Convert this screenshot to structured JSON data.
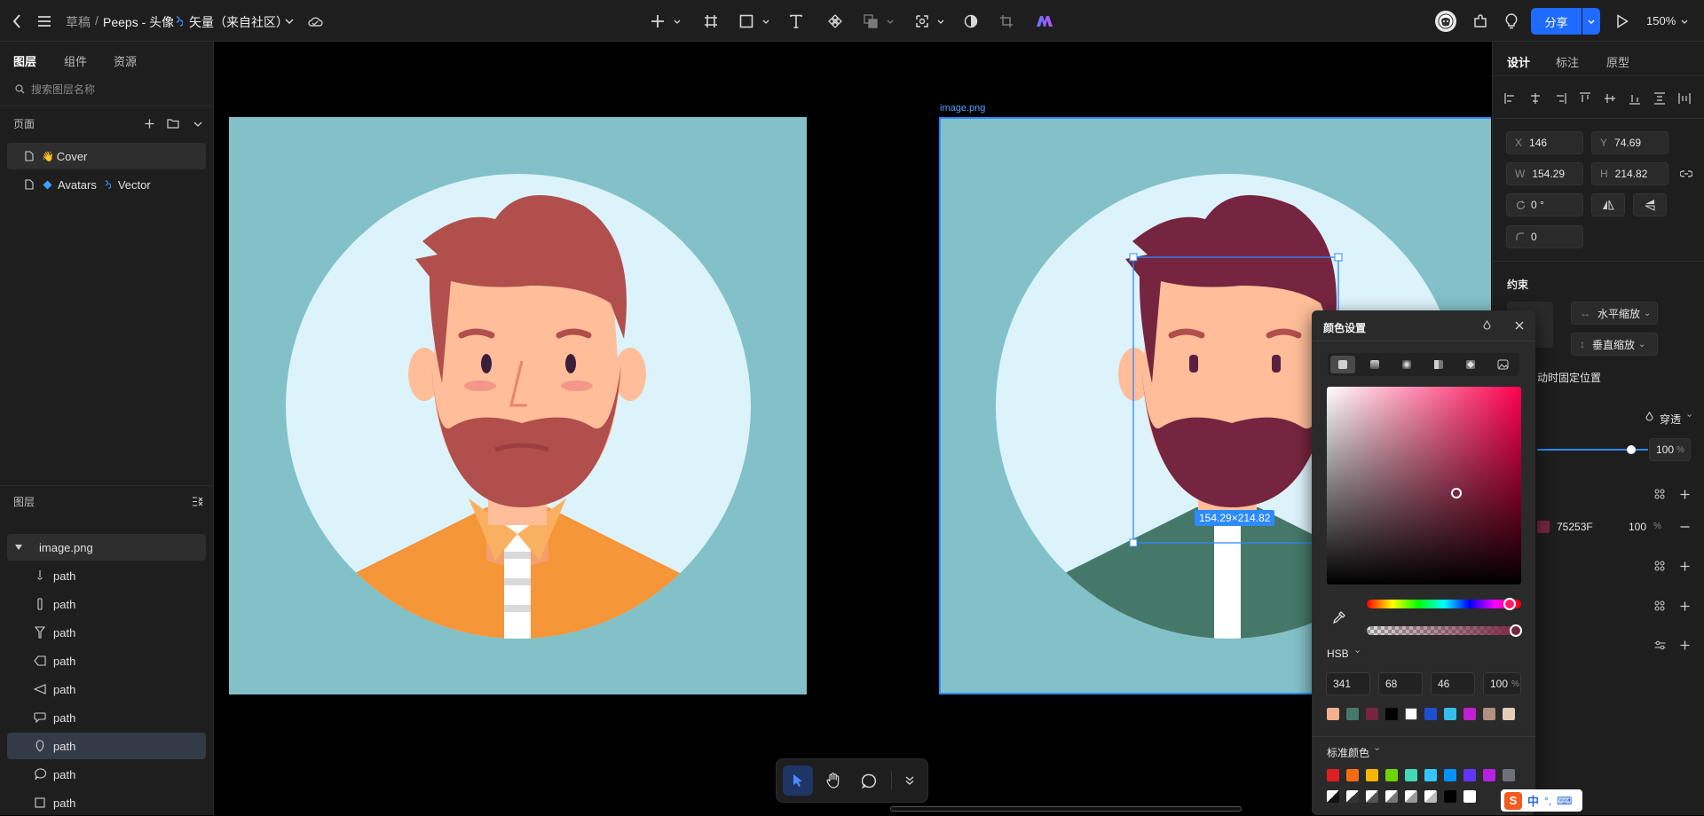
{
  "topbar": {
    "breadcrumb_root": "草稿",
    "breadcrumb_sep": "/",
    "file_title": "Peeps - 头像",
    "file_suffix": "矢量（来自社区）",
    "share_label": "分享",
    "zoom": "150%"
  },
  "left_panel": {
    "tabs": [
      "图层",
      "组件",
      "资源"
    ],
    "search_placeholder": "搜索图层名称",
    "pages_title": "页面",
    "pages": [
      {
        "emoji": "👋",
        "label": "Cover"
      },
      {
        "label": "Avatars",
        "suffix": "Vector"
      }
    ],
    "layers_title": "图层",
    "layers": [
      {
        "label": "image.png",
        "icon": "caret-icon"
      },
      {
        "label": "path",
        "icon": "path-shape-1-icon"
      },
      {
        "label": "path",
        "icon": "path-shape-2-icon"
      },
      {
        "label": "path",
        "icon": "path-shape-3-icon"
      },
      {
        "label": "path",
        "icon": "path-shape-4-icon"
      },
      {
        "label": "path",
        "icon": "path-shape-5-icon"
      },
      {
        "label": "path",
        "icon": "path-shape-6-icon"
      },
      {
        "label": "path",
        "icon": "path-shape-7-icon",
        "selected": true
      },
      {
        "label": "path",
        "icon": "path-shape-8-icon"
      },
      {
        "label": "path",
        "icon": "path-shape-9-icon"
      }
    ]
  },
  "canvas": {
    "frame_label": "image.png",
    "selection_size": "154.29×214.82",
    "colors": {
      "bg": "#82C1C7",
      "circle": "#DDF3FB",
      "hair_left": "#B14F4C",
      "hair_right": "#75253F",
      "skin": "#FFBE99",
      "shirt_left": "#F59638",
      "shirt_right": "#457868",
      "accent": "#2E8BFF"
    }
  },
  "right_panel": {
    "tabs": [
      "设计",
      "标注",
      "原型"
    ],
    "x_label": "X",
    "x_value": "146",
    "y_label": "Y",
    "y_value": "74.69",
    "w_label": "W",
    "w_value": "154.29",
    "h_label": "H",
    "h_value": "214.82",
    "rotation": "0 °",
    "radius": "0",
    "constraints_title": "约束",
    "horizontal": "水平缩放",
    "vertical": "垂直缩放",
    "fixed_position": "动时固定位置",
    "blend_mode": "穿透",
    "opacity": "100",
    "percent": "%",
    "fill_hex": "75253F",
    "fill_opacity": "100"
  },
  "color_popup": {
    "title": "颜色设置",
    "mode": "HSB",
    "h": "341",
    "s": "68",
    "b": "46",
    "a": "100",
    "percent": "%",
    "recent_colors": [
      "#F5B08E",
      "#457868",
      "#75253F",
      "#000000",
      "#FFFFFF",
      "#1F4FD1",
      "#37BDEB",
      "#C020D0",
      "#B09080",
      "#E5CDB8"
    ],
    "standard_title": "标准颜色",
    "standard_colors": [
      "#E02020",
      "#F76B15",
      "#F7B500",
      "#6DD400",
      "#44D7B6",
      "#32C5FF",
      "#0091FF",
      "#6236FF",
      "#B620E0",
      "#6D7278"
    ]
  },
  "ime": {
    "label": "中"
  }
}
